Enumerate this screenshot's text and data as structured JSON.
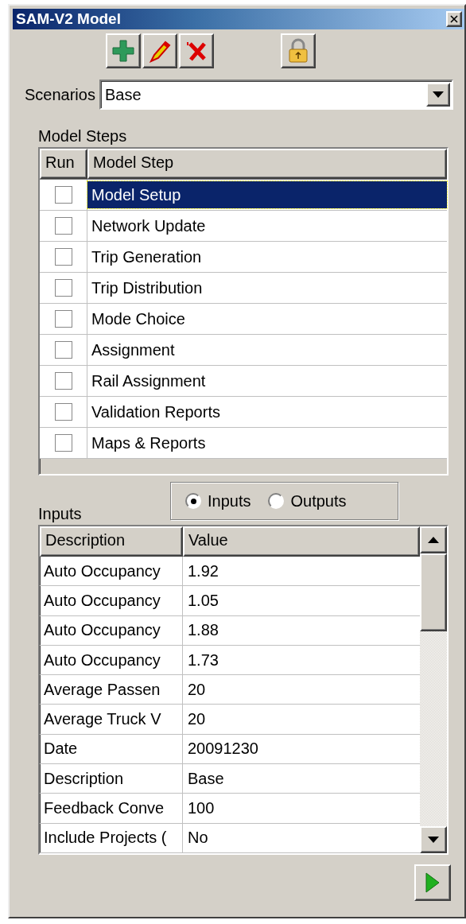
{
  "window": {
    "title": "SAM-V2 Model"
  },
  "scenario": {
    "label": "Scenarios",
    "value": "Base"
  },
  "model_steps": {
    "label": "Model Steps",
    "columns": [
      "Run",
      "Model Step"
    ],
    "rows": [
      {
        "name": "Model Setup",
        "run": false,
        "selected": true
      },
      {
        "name": "Network Update",
        "run": false,
        "selected": false
      },
      {
        "name": "Trip Generation",
        "run": false,
        "selected": false
      },
      {
        "name": "Trip Distribution",
        "run": false,
        "selected": false
      },
      {
        "name": "Mode Choice",
        "run": false,
        "selected": false
      },
      {
        "name": "Assignment",
        "run": false,
        "selected": false
      },
      {
        "name": "Rail Assignment",
        "run": false,
        "selected": false
      },
      {
        "name": "Validation Reports",
        "run": false,
        "selected": false
      },
      {
        "name": "Maps & Reports",
        "run": false,
        "selected": false
      }
    ]
  },
  "parameters": {
    "label": "Inputs",
    "view_options": [
      {
        "label": "Inputs",
        "selected": true
      },
      {
        "label": "Outputs",
        "selected": false
      }
    ],
    "columns": [
      "Description",
      "Value"
    ],
    "rows": [
      {
        "description": "Auto Occupancy",
        "value": "1.92"
      },
      {
        "description": "Auto Occupancy",
        "value": "1.05"
      },
      {
        "description": "Auto Occupancy",
        "value": "1.88"
      },
      {
        "description": "Auto Occupancy",
        "value": "1.73"
      },
      {
        "description": "Average Passen",
        "value": "20"
      },
      {
        "description": "Average Truck V",
        "value": "20"
      },
      {
        "description": "Date",
        "value": "20091230"
      },
      {
        "description": "Description",
        "value": "Base"
      },
      {
        "description": "Feedback Conve",
        "value": "100"
      },
      {
        "description": "Include Projects (",
        "value": "No"
      }
    ]
  }
}
